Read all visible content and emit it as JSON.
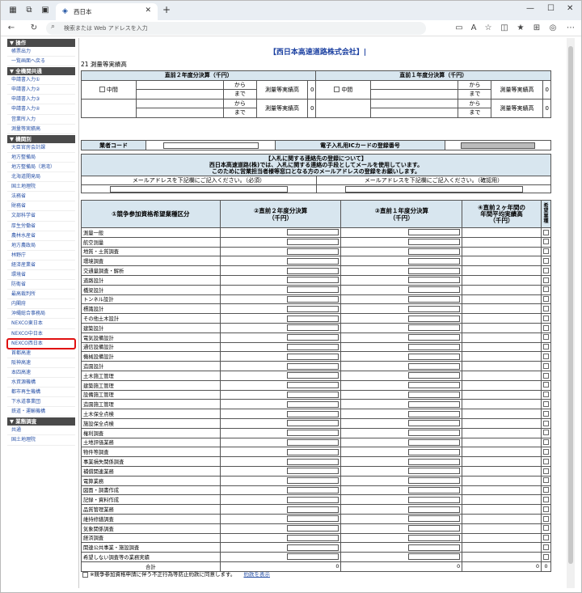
{
  "browser": {
    "tab_title": "西日本",
    "address_placeholder": "検索または Web アドレスを入力"
  },
  "sidebar": {
    "sections": [
      {
        "title": "▼ 操作",
        "items": [
          "帳票出力",
          "一覧画面へ戻る"
        ]
      },
      {
        "title": "▼ 全機関共通",
        "items": [
          "申請書入力①",
          "申請書入力②",
          "申請書入力③",
          "申請書入力④",
          "営業所入力",
          "測量等実績高"
        ]
      },
      {
        "title": "▼ 機関別",
        "items": [
          "大臣官房会計課",
          "地方整備局",
          "地方整備局（港湾）",
          "北海道開発局",
          "国土地理院",
          "法務省",
          "財務省",
          "文部科学省",
          "厚生労働省",
          "農林水産省",
          "地方農政局",
          "林野庁",
          "経済産業省",
          "環境省",
          "防衛省",
          "最高裁判所",
          "内閣府",
          "沖縄総合事務局",
          "NEXCO東日本",
          "NEXCO中日本",
          "NEXCO西日本",
          "首都高速",
          "阪神高速",
          "本四高速",
          "水資源機構",
          "都市再生機構",
          "下水道事業団",
          "鉄道・運輸機構"
        ]
      },
      {
        "title": "▼ 業態調査",
        "items": [
          "共通",
          "国土地理院"
        ]
      }
    ],
    "selected": "NEXCO西日本"
  },
  "main": {
    "company": "【西日本高速道路株式会社】|",
    "section_title": "21 測量等実績高",
    "t1": {
      "prev2": "直前２年度分決算（千円）",
      "prev1": "直前１年度分決算（千円）",
      "mid": "中間",
      "from": "から",
      "to": "まで",
      "label": "測量等実績高",
      "zero": "0"
    },
    "t2": {
      "vendor_code": "業者コード",
      "ic_card": "電子入札用ICカードの登録番号"
    },
    "t3": {
      "line1": "【入札に関する連絡先の登録について】",
      "line2": "西日本高速道路(株)では、入札に関する連絡の手段としてメールを使用しています。",
      "line3": "このために営業担当者様等窓口となる方のメールアドレスの登録をお願いします。",
      "mail_req": "メールアドレスを下記欄にご記入ください。（必須）",
      "mail_confirm": "メールアドレスを下記欄にご記入ください。（確認用）"
    },
    "t4": {
      "col1": "①競争参加資格希望業種区分",
      "col2a": "②直前２年度分決算",
      "col2b": "（千円）",
      "col3a": "③直前１年度分決算",
      "col3b": "（千円）",
      "col4a": "④直前２ヶ年間の",
      "col4b": "年間平均実績高",
      "col4c": "（千円）",
      "col5": "希望業種",
      "rows": [
        "測量一般",
        "航空測量",
        "地質・土質調査",
        "環境調査",
        "交通量調査・解析",
        "道路設計",
        "橋梁設計",
        "トンネル設計",
        "標識設計",
        "その他土木設計",
        "建築設計",
        "電気設備設計",
        "通信設備設計",
        "機械設備設計",
        "造園設計",
        "土木施工管理",
        "建築施工管理",
        "設備施工管理",
        "造園施工管理",
        "土木保全点検",
        "施設保全点検",
        "権利調査",
        "土地評価業務",
        "物件等調査",
        "事業損失関係調査",
        "補償関連業務",
        "電算業務",
        "図面・調書作成",
        "記録・資料作成",
        "品質管理業務",
        "維持修繕調査",
        "気象関係調査",
        "経済調査",
        "関連公共事業・施設調査",
        "希望しない調査等の業務実績"
      ],
      "total": "合計",
      "zero": "0"
    },
    "footer": {
      "agree": "※競争参加資格申請に伴う不正行為等防止約款に同意します。",
      "link": "約款を表示"
    }
  }
}
